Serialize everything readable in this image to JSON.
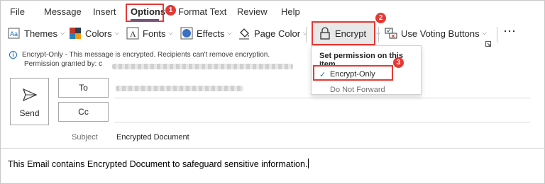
{
  "menu": {
    "tabs": [
      "File",
      "Message",
      "Insert",
      "Options",
      "Format Text",
      "Review",
      "Help"
    ],
    "active_tab": "Options"
  },
  "ribbon": {
    "themes": "Themes",
    "colors": "Colors",
    "fonts": "Fonts",
    "effects": "Effects",
    "page_color": "Page Color",
    "encrypt": "Encrypt",
    "voting": "Use Voting Buttons",
    "more": "⋯"
  },
  "steps": [
    "1",
    "2",
    "3"
  ],
  "info": {
    "line1": "Encrypt-Only - This message is encrypted. Recipients can't remove encryption.",
    "line2": "Permission granted by: c"
  },
  "compose": {
    "send": "Send",
    "to": "To",
    "cc": "Cc",
    "subject_label": "Subject",
    "subject_value": "Encrypted Document",
    "body": "This Email contains Encrypted Document to safeguard sensitive information."
  },
  "dropdown": {
    "title": "Set permission on this item",
    "items": [
      "Encrypt-Only",
      "Do Not Forward"
    ],
    "checked": "✓"
  },
  "colors": {
    "accent": "#1e6bb8",
    "highlight": "#e53935"
  }
}
